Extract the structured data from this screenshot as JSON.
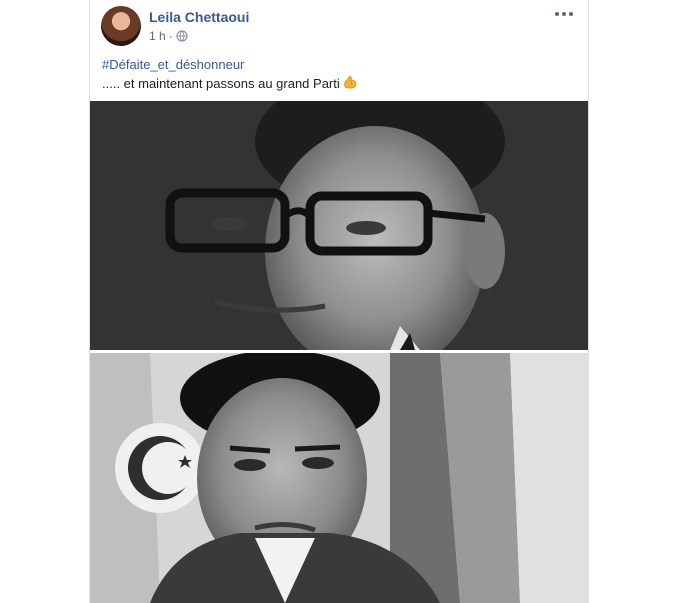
{
  "post": {
    "author_name": "Leila Chettaoui",
    "timestamp": "1 h",
    "separator": "·",
    "hashtag": "#Défaite_et_déshonneur",
    "body_text": "..... et maintenant passons au grand Parti",
    "emoji": "flexed-biceps-emoji",
    "privacy_icon": "globe-icon",
    "more_icon": "more-options-icon"
  },
  "photos": [
    {
      "name": "photo-top"
    },
    {
      "name": "photo-bottom"
    }
  ]
}
